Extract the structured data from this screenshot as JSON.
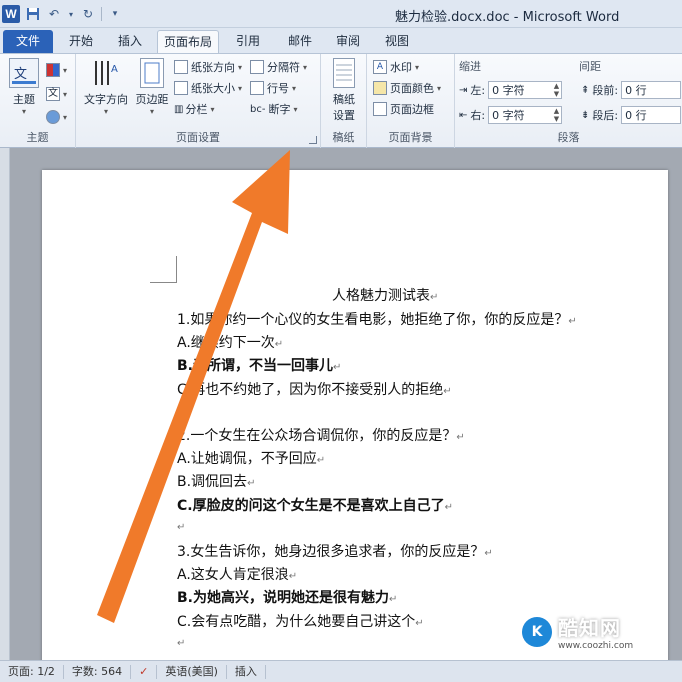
{
  "app": {
    "logo_letter": "W",
    "window_title": "魅力检验.docx.doc - Microsoft Word"
  },
  "tabs": [
    "文件",
    "开始",
    "插入",
    "页面布局",
    "引用",
    "邮件",
    "审阅",
    "视图"
  ],
  "ribbon": {
    "theme_group": {
      "label": "主题",
      "theme_btn": "主题"
    },
    "page_setup": {
      "label": "页面设置",
      "text_direction": "文字方向",
      "margins": "页边距",
      "orientation": "纸张方向",
      "size": "纸张大小",
      "columns": "分栏",
      "breaks": "分隔符",
      "line_numbers": "行号",
      "hyphenation": "断字"
    },
    "draft": {
      "label": "稿纸",
      "btn": "稿纸\n设置",
      "btn_line1": "稿纸",
      "btn_line2": "设置"
    },
    "background": {
      "label": "页面背景",
      "watermark": "水印",
      "page_color": "页面颜色",
      "page_borders": "页面边框"
    },
    "paragraph": {
      "label": "段落",
      "indent_title": "缩进",
      "left_label": "左:",
      "left_value": "0 字符",
      "right_label": "右:",
      "right_value": "0 字符",
      "spacing_title": "间距",
      "before_label": "段前:",
      "before_value": "0 行",
      "after_label": "段后:",
      "after_value": "0 行"
    }
  },
  "document": {
    "title": "人格魅力测试表",
    "lines": [
      {
        "text": "1.如果你约一个心仪的女生看电影，她拒绝了你，你的反应是？",
        "bold": false
      },
      {
        "text": "A.继续约下一次",
        "bold": false
      },
      {
        "text": "B.无所谓，不当一回事儿",
        "bold": true
      },
      {
        "text": "C.再也不约她了，因为你不接受别人的拒绝",
        "bold": false
      },
      {
        "text": "",
        "bold": false
      },
      {
        "text": "2.一个女生在公众场合调侃你，你的反应是？",
        "bold": false
      },
      {
        "text": "A.让她调侃，不予回应",
        "bold": false
      },
      {
        "text": "B.调侃回去",
        "bold": false
      },
      {
        "text": "C.厚脸皮的问这个女生是不是喜欢上自己了",
        "bold": true
      },
      {
        "text": "",
        "bold": false
      },
      {
        "text": "3.女生告诉你，她身边很多追求者，你的反应是？",
        "bold": false
      },
      {
        "text": "A.这女人肯定很浪",
        "bold": false
      },
      {
        "text": "B.为她高兴，说明她还是很有魅力",
        "bold": true
      },
      {
        "text": "C.会有点吃醋，为什么她要自己讲这个",
        "bold": false
      },
      {
        "text": "",
        "bold": false
      }
    ]
  },
  "status": {
    "page": "页面: 1/2",
    "words": "字数: 564",
    "language": "英语(美国)",
    "mode": "插入"
  },
  "watermark": {
    "name": "酷知网",
    "url": "www.coozhi.com"
  },
  "colors": {
    "arrow": "#f07a2a",
    "file_tab": "#2b62b8"
  }
}
